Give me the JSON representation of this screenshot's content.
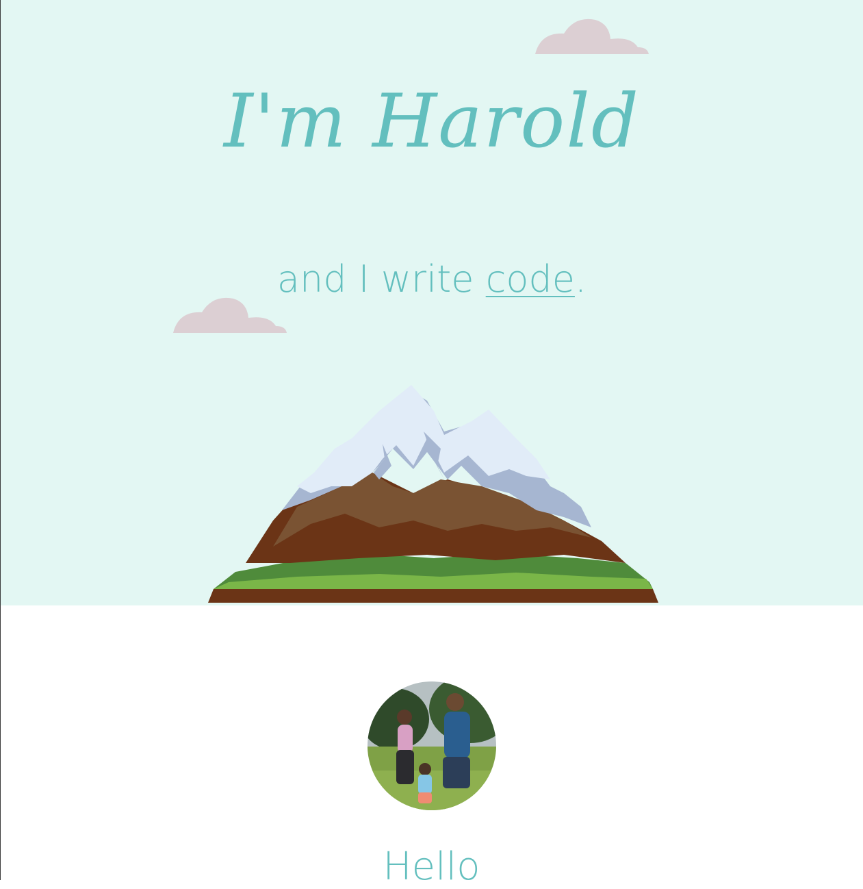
{
  "hero": {
    "title": "I'm Harold",
    "subtitle_prefix": "and I write ",
    "subtitle_link": "code",
    "subtitle_suffix": "."
  },
  "about": {
    "heading": "Hello"
  },
  "colors": {
    "sky": "#e3f7f3",
    "accent": "#63bfbe",
    "cloud": "#dccfd3"
  },
  "icons": {
    "cloud": "cloud-icon",
    "mountain": "mountain-illustration"
  }
}
